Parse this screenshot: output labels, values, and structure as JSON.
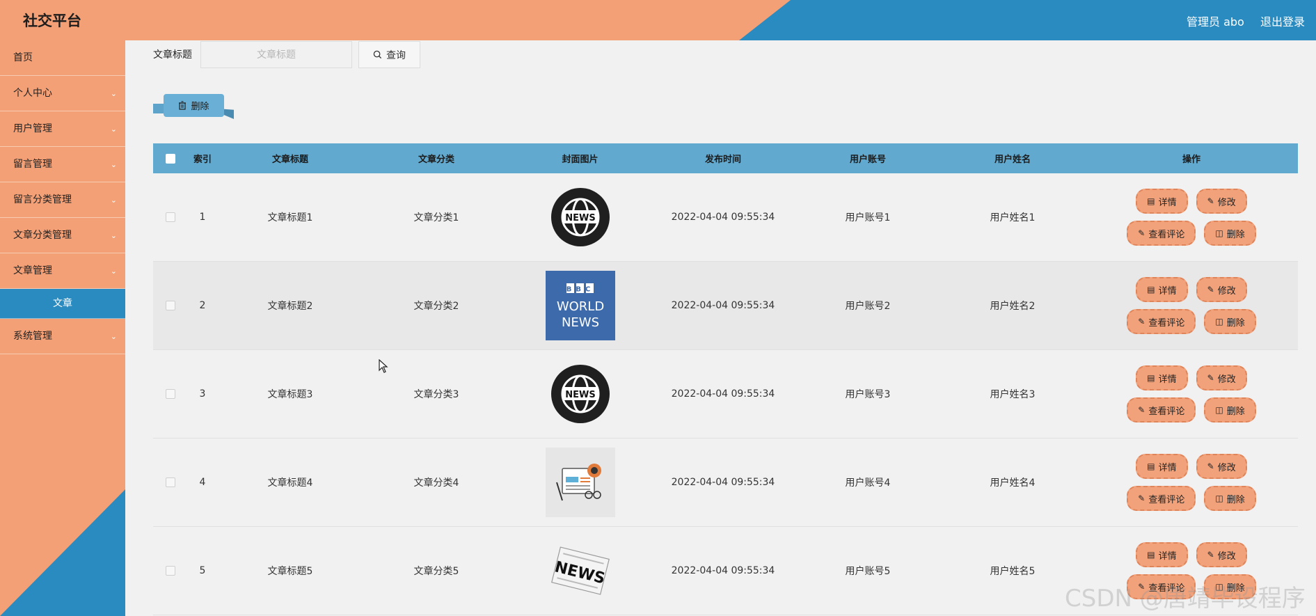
{
  "header": {
    "title": "社交平台",
    "user": "管理员 abo",
    "logout": "退出登录"
  },
  "sidebar": {
    "items": [
      {
        "label": "首页",
        "chevron": false
      },
      {
        "label": "个人中心",
        "chevron": true
      },
      {
        "label": "用户管理",
        "chevron": true
      },
      {
        "label": "留言管理",
        "chevron": true
      },
      {
        "label": "留言分类管理",
        "chevron": true
      },
      {
        "label": "文章分类管理",
        "chevron": true
      },
      {
        "label": "文章管理",
        "chevron": true
      },
      {
        "label": "文章",
        "sub": true
      },
      {
        "label": "系统管理",
        "chevron": true
      }
    ]
  },
  "search": {
    "label": "文章标题",
    "placeholder": "文章标题",
    "button": "查询"
  },
  "toolbar": {
    "delete_label": "删除"
  },
  "table": {
    "columns": [
      "索引",
      "文章标题",
      "文章分类",
      "封面图片",
      "发布时间",
      "用户账号",
      "用户姓名",
      "操作"
    ],
    "rows": [
      {
        "index": "1",
        "title": "文章标题1",
        "category": "文章分类1",
        "cover": "news-globe",
        "time": "2022-04-04 09:55:34",
        "account": "用户账号1",
        "name": "用户姓名1"
      },
      {
        "index": "2",
        "title": "文章标题2",
        "category": "文章分类2",
        "cover": "bbc-world-news",
        "time": "2022-04-04 09:55:34",
        "account": "用户账号2",
        "name": "用户姓名2"
      },
      {
        "index": "3",
        "title": "文章标题3",
        "category": "文章分类3",
        "cover": "news-globe",
        "time": "2022-04-04 09:55:34",
        "account": "用户账号3",
        "name": "用户姓名3"
      },
      {
        "index": "4",
        "title": "文章标题4",
        "category": "文章分类4",
        "cover": "newspaper-illustration",
        "time": "2022-04-04 09:55:34",
        "account": "用户账号4",
        "name": "用户姓名4"
      },
      {
        "index": "5",
        "title": "文章标题5",
        "category": "文章分类5",
        "cover": "news-paper",
        "time": "2022-04-04 09:55:34",
        "account": "用户账号5",
        "name": "用户姓名5"
      }
    ],
    "actions": {
      "detail": "详情",
      "edit": "修改",
      "comments": "查看评论",
      "delete": "删除"
    }
  },
  "cover_text": {
    "news": "NEWS",
    "bbc": "BBC",
    "world": "WORLD",
    "news_caps": "NEWS"
  },
  "watermark": "CSDN @唐靖毕设程序",
  "colors": {
    "orange": "#f3a076",
    "blue": "#2a8bc0",
    "table_header": "#62a9cf",
    "action_button": "#f1a27b"
  }
}
